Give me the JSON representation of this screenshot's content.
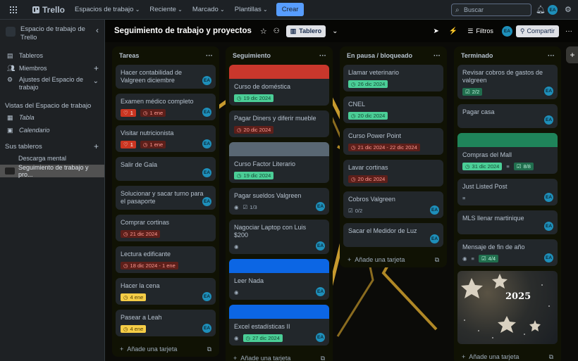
{
  "topbar": {
    "app_name": "Trello",
    "nav": [
      "Espacios de trabajo",
      "Reciente",
      "Marcado",
      "Plantillas"
    ],
    "create_label": "Crear",
    "search_placeholder": "Buscar",
    "avatar_initials": "EA"
  },
  "sidebar": {
    "workspace_name": "Espacio de trabajo de Trello",
    "items": [
      {
        "label": "Tableros",
        "icon": "board-icon"
      },
      {
        "label": "Miembros",
        "icon": "members-icon"
      },
      {
        "label": "Ajustes del Espacio de trabajo",
        "icon": "gear-icon"
      }
    ],
    "views_heading": "Vistas del Espacio de trabajo",
    "views": [
      {
        "label": "Tabla",
        "icon": "table-icon"
      },
      {
        "label": "Calendario",
        "icon": "calendar-icon"
      }
    ],
    "boards_heading": "Sus tableros",
    "boards": [
      {
        "label": "Descarga mental",
        "active": false
      },
      {
        "label": "Seguimiento de trabajo y pro...",
        "active": true
      }
    ]
  },
  "board": {
    "title": "Seguimiento de trabajo y proyectos",
    "view_label": "Tablero",
    "filters_label": "Filtros",
    "share_label": "Compartir",
    "avatar_initials": "EA"
  },
  "lists": [
    {
      "name": "Tareas",
      "add_label": "Añade una tarjeta",
      "cards": [
        {
          "title": "Hacer contabilidad de Valgreen diciembre",
          "badges": [],
          "avatar": "EA"
        },
        {
          "title": "Examen médico completo",
          "badges": [
            {
              "kind": "redb",
              "text": "1",
              "icon": "heart"
            },
            {
              "kind": "red",
              "text": "1 ene",
              "icon": "clock"
            }
          ],
          "avatar": "EA"
        },
        {
          "title": "Visitar nutricionista",
          "badges": [
            {
              "kind": "redb",
              "text": "1",
              "icon": "heart"
            },
            {
              "kind": "red",
              "text": "1 ene",
              "icon": "clock"
            }
          ],
          "avatar": "EA"
        },
        {
          "title": "Salir de Gala",
          "badges": [],
          "avatar": "EA"
        },
        {
          "title": "Solucionar y sacar turno para el pasaporte",
          "badges": [],
          "avatar": "EA"
        },
        {
          "title": "Comprar cortinas",
          "badges": [
            {
              "kind": "red",
              "text": "21 dic 2024",
              "icon": "clock"
            }
          ],
          "avatar": ""
        },
        {
          "title": "Lectura edificante",
          "badges": [
            {
              "kind": "red",
              "text": "18 dic 2024 - 1 ene",
              "icon": "clock"
            }
          ],
          "avatar": ""
        },
        {
          "title": "Hacer la cena",
          "badges": [
            {
              "kind": "yellow",
              "text": "4 ene",
              "icon": "clock"
            }
          ],
          "avatar": "EA"
        },
        {
          "title": "Pasear a Leah",
          "badges": [
            {
              "kind": "yellow",
              "text": "4 ene",
              "icon": "clock"
            }
          ],
          "avatar": "EA"
        }
      ]
    },
    {
      "name": "Seguimiento",
      "add_label": "Añade una tarjeta",
      "cards": [
        {
          "title": "Curso de doméstica",
          "cover": "#c9372c",
          "badges": [
            {
              "kind": "green",
              "text": "19 dic 2024",
              "icon": "clock"
            }
          ],
          "avatar": ""
        },
        {
          "title": "Pagar Diners y diferir mueble",
          "badges": [
            {
              "kind": "red",
              "text": "20 dic 2024",
              "icon": "clock"
            }
          ],
          "avatar": ""
        },
        {
          "title": "Curso Factor Literario",
          "cover": "#596773",
          "badges": [
            {
              "kind": "green",
              "text": "19 dic 2024",
              "icon": "clock"
            }
          ],
          "avatar": ""
        },
        {
          "title": "Pagar sueldos Valgreen",
          "badges": [
            {
              "kind": "plain",
              "text": "",
              "icon": "eye"
            },
            {
              "kind": "plain",
              "text": "1/3",
              "icon": "check"
            }
          ],
          "avatar": "EA"
        },
        {
          "title": "Nagociar Laptop con Luis $200",
          "badges": [
            {
              "kind": "plain",
              "text": "",
              "icon": "eye"
            }
          ],
          "avatar": "EA"
        },
        {
          "title": "Leer Nada",
          "cover": "#0c66e4",
          "badges": [
            {
              "kind": "plain",
              "text": "",
              "icon": "eye"
            }
          ],
          "avatar": "EA"
        },
        {
          "title": "Excel estadísticas II",
          "cover": "#0c66e4",
          "badges": [
            {
              "kind": "plain",
              "text": "",
              "icon": "eye"
            },
            {
              "kind": "green",
              "text": "27 dic 2024",
              "icon": "clock"
            }
          ],
          "avatar": "EA"
        }
      ]
    },
    {
      "name": "En pausa / bloqueado",
      "add_label": "Añade una tarjeta",
      "cards": [
        {
          "title": "Llamar veterinario",
          "badges": [
            {
              "kind": "green",
              "text": "26 dic 2024",
              "icon": "clock"
            }
          ],
          "avatar": ""
        },
        {
          "title": "CNEL",
          "badges": [
            {
              "kind": "green",
              "text": "20 dic 2024",
              "icon": "clock"
            }
          ],
          "avatar": ""
        },
        {
          "title": "Curso Power Point",
          "badges": [
            {
              "kind": "red",
              "text": "21 dic 2024 - 22 dic 2024",
              "icon": "clock"
            }
          ],
          "avatar": ""
        },
        {
          "title": "Lavar cortinas",
          "badges": [
            {
              "kind": "red",
              "text": "20 dic 2024",
              "icon": "clock"
            }
          ],
          "avatar": ""
        },
        {
          "title": "Cobros Valgreen",
          "badges": [
            {
              "kind": "plain",
              "text": "0/2",
              "icon": "check"
            }
          ],
          "avatar": "EA"
        },
        {
          "title": "Sacar el Medidor de Luz",
          "badges": [],
          "avatar": "EA"
        }
      ]
    },
    {
      "name": "Terminado",
      "add_label": "Añade una tarjeta",
      "cards": [
        {
          "title": "Revisar cobros de gastos de valgreen",
          "badges": [
            {
              "kind": "grn2",
              "text": "2/2",
              "icon": "check"
            }
          ],
          "avatar": "EA"
        },
        {
          "title": "Pagar casa",
          "badges": [],
          "avatar": "EA"
        },
        {
          "title": "Compras del Mall",
          "cover": "#1f845a",
          "badges": [
            {
              "kind": "green",
              "text": "31 dic 2024",
              "icon": "clock"
            },
            {
              "kind": "plain",
              "text": "",
              "icon": "desc"
            },
            {
              "kind": "grn2",
              "text": "8/8",
              "icon": "check"
            }
          ],
          "avatar": ""
        },
        {
          "title": "Just Listed Post",
          "badges": [
            {
              "kind": "plain",
              "text": "",
              "icon": "desc"
            }
          ],
          "avatar": "EA"
        },
        {
          "title": "MLS llenar martinique",
          "badges": [],
          "avatar": "EA"
        },
        {
          "title": "Mensaje de fin de año",
          "badges": [
            {
              "kind": "plain",
              "text": "",
              "icon": "eye"
            },
            {
              "kind": "plain",
              "text": "",
              "icon": "desc"
            },
            {
              "kind": "grn2",
              "text": "4/4",
              "icon": "check"
            }
          ],
          "avatar": "EA"
        }
      ],
      "image_card_text": "2025"
    }
  ]
}
